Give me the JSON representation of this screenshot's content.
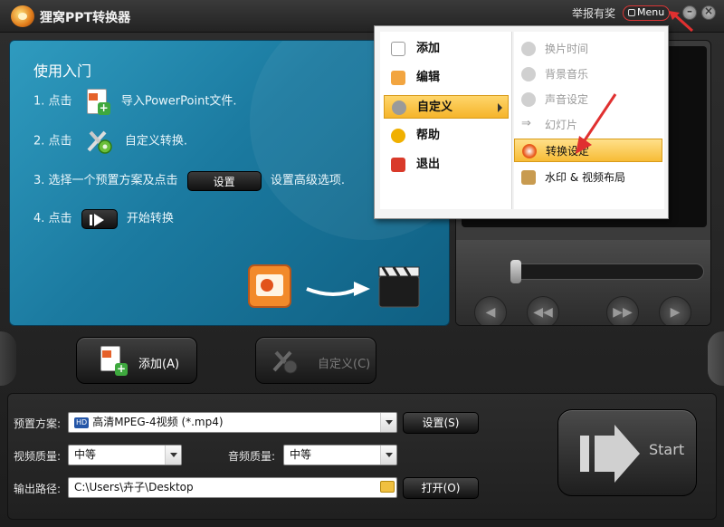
{
  "window": {
    "title": "狸窝PPT转换器",
    "report_link": "举报有奖",
    "menu_button": "Menu"
  },
  "guide": {
    "title": "使用入门",
    "step1_prefix": "1. 点击",
    "step1_suffix": "导入PowerPoint文件.",
    "step2_prefix": "2. 点击",
    "step2_suffix": "自定义转换.",
    "step3_prefix": "3. 选择一个预置方案及点击",
    "step3_chip": "设置",
    "step3_suffix": "设置高级选项.",
    "step4_prefix": "4. 点击",
    "step4_suffix": "开始转换"
  },
  "actions": {
    "add_label": "添加(A)",
    "custom_label": "自定义(C)"
  },
  "settings": {
    "preset_label": "预置方案:",
    "preset_value": "高清MPEG-4视频 (*.mp4)",
    "preset_badge": "HD",
    "preset_button": "设置(S)",
    "video_quality_label": "视频质量:",
    "video_quality_value": "中等",
    "audio_quality_label": "音频质量:",
    "audio_quality_value": "中等",
    "output_label": "输出路径:",
    "output_value": "C:\\Users\\卉子\\Desktop",
    "open_button": "打开(O)",
    "start_label": "Start"
  },
  "menu": {
    "main_items": [
      {
        "label": "添加",
        "icon": "add-doc-icon"
      },
      {
        "label": "编辑",
        "icon": "edit-icon"
      },
      {
        "label": "自定义",
        "icon": "gear-icon"
      },
      {
        "label": "帮助",
        "icon": "help-icon"
      },
      {
        "label": "退出",
        "icon": "exit-icon"
      }
    ],
    "sub_items": [
      {
        "label": "换片时间",
        "icon": "timer-icon"
      },
      {
        "label": "背景音乐",
        "icon": "music-icon"
      },
      {
        "label": "声音设定",
        "icon": "sound-icon"
      },
      {
        "label": "幻灯片",
        "icon": "arrow-icon"
      },
      {
        "label": "转换设定",
        "icon": "convert-icon"
      },
      {
        "label": "水印 & 视频布局",
        "icon": "watermark-icon"
      }
    ]
  },
  "colors": {
    "accent_highlight": "#f5b42a",
    "panel_blue": "#1b7aa0",
    "annotation_red": "#e03030"
  }
}
